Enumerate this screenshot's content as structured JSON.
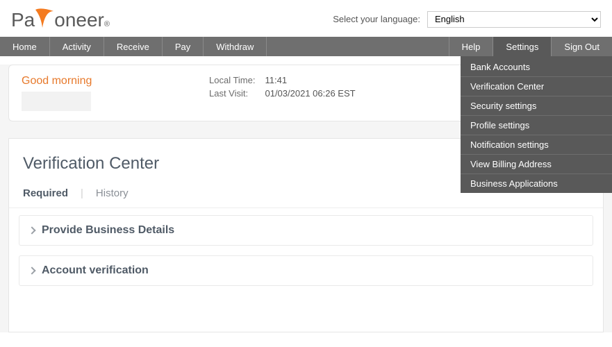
{
  "lang": {
    "label": "Select your language:",
    "selected": "English"
  },
  "logo": {
    "pa": "Pa",
    "oneer": "oneer",
    "reg": "®"
  },
  "nav": {
    "home": "Home",
    "activity": "Activity",
    "receive": "Receive",
    "pay": "Pay",
    "withdraw": "Withdraw",
    "help": "Help",
    "settings": "Settings",
    "signout": "Sign Out"
  },
  "settings_menu": {
    "bank_accounts": "Bank Accounts",
    "verification_center": "Verification Center",
    "security_settings": "Security settings",
    "profile_settings": "Profile settings",
    "notification_settings": "Notification settings",
    "view_billing_address": "View Billing Address",
    "business_applications": "Business Applications"
  },
  "greeting": {
    "text": "Good morning",
    "local_time_label": "Local Time:",
    "local_time_value": "11:41",
    "last_visit_label": "Last Visit:",
    "last_visit_value": "01/03/2021 06:26 EST"
  },
  "verification": {
    "title": "Verification Center",
    "tab_required": "Required",
    "tab_history": "History",
    "items": {
      "business_details": "Provide Business Details",
      "account_verification": "Account verification"
    }
  }
}
